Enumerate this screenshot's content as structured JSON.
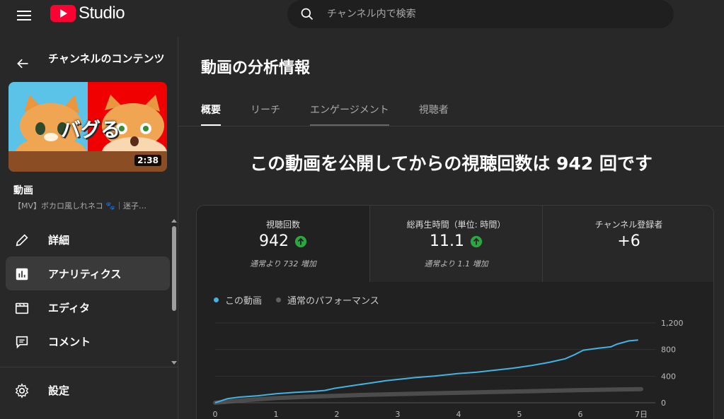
{
  "header": {
    "brand": "Studio",
    "search_placeholder": "チャンネル内で検索"
  },
  "sidebar": {
    "back_title": "チャンネルのコンテンツ",
    "thumbnail": {
      "duration": "2:38",
      "overlay_text": "バグる"
    },
    "video_label": "動画",
    "video_subtitle": "【MV】ボカロ風しれネコ 🐾｜迷子…",
    "items": [
      {
        "label": "詳細",
        "icon": "pencil-icon"
      },
      {
        "label": "アナリティクス",
        "icon": "analytics-icon",
        "active": true
      },
      {
        "label": "エディタ",
        "icon": "editor-icon"
      },
      {
        "label": "コメント",
        "icon": "comment-icon"
      }
    ],
    "bottom_items": [
      {
        "label": "設定",
        "icon": "gear-icon"
      }
    ]
  },
  "main": {
    "title": "動画の分析情報",
    "tabs": [
      {
        "label": "概要",
        "active": true
      },
      {
        "label": "リーチ"
      },
      {
        "label": "エンゲージメント"
      },
      {
        "label": "視聴者"
      }
    ],
    "headline": "この動画を公開してからの視聴回数は 942 回です",
    "metrics": [
      {
        "label": "視聴回数",
        "value": "942",
        "trend": "up",
        "note": "通常より 732 増加"
      },
      {
        "label": "総再生時間（単位: 時間）",
        "value": "11.1",
        "trend": "up",
        "note": "通常より 1.1 増加"
      },
      {
        "label": "チャンネル登録者",
        "value": "+6"
      }
    ],
    "legend": [
      {
        "label": "この動画",
        "color": "#41b4e3"
      },
      {
        "label": "通常のパフォーマンス",
        "color": "#606060"
      }
    ]
  },
  "chart_data": {
    "type": "line",
    "x_ticks": [
      "0",
      "1",
      "2",
      "3",
      "4",
      "5",
      "6",
      "7日"
    ],
    "y_ticks": [
      "0",
      "400",
      "800",
      "1,200"
    ],
    "xlim": [
      0,
      7
    ],
    "ylim": [
      0,
      1200
    ],
    "grid": true,
    "legend_position": "top-left",
    "series": [
      {
        "name": "この動画",
        "color": "#41b4e3",
        "points": [
          [
            0,
            0
          ],
          [
            0.2,
            60
          ],
          [
            0.4,
            85
          ],
          [
            0.7,
            105
          ],
          [
            1,
            135
          ],
          [
            1.3,
            155
          ],
          [
            1.6,
            170
          ],
          [
            1.8,
            185
          ],
          [
            1.95,
            215
          ],
          [
            2.2,
            250
          ],
          [
            2.5,
            290
          ],
          [
            2.8,
            330
          ],
          [
            3,
            350
          ],
          [
            3.3,
            380
          ],
          [
            3.6,
            400
          ],
          [
            4,
            440
          ],
          [
            4.3,
            460
          ],
          [
            4.6,
            490
          ],
          [
            4.9,
            520
          ],
          [
            5.2,
            560
          ],
          [
            5.5,
            610
          ],
          [
            5.75,
            660
          ],
          [
            5.9,
            720
          ],
          [
            6.05,
            790
          ],
          [
            6.3,
            820
          ],
          [
            6.5,
            840
          ],
          [
            6.6,
            880
          ],
          [
            6.8,
            930
          ],
          [
            6.95,
            942
          ]
        ]
      },
      {
        "name": "通常のパフォーマンス",
        "color": "#606060",
        "points": [
          [
            0,
            0
          ],
          [
            0.5,
            40
          ],
          [
            1,
            70
          ],
          [
            1.5,
            90
          ],
          [
            2,
            105
          ],
          [
            2.5,
            120
          ],
          [
            3,
            130
          ],
          [
            3.5,
            140
          ],
          [
            4,
            150
          ],
          [
            4.5,
            160
          ],
          [
            5,
            170
          ],
          [
            5.5,
            180
          ],
          [
            6,
            190
          ],
          [
            6.5,
            198
          ],
          [
            7,
            205
          ]
        ]
      }
    ]
  }
}
